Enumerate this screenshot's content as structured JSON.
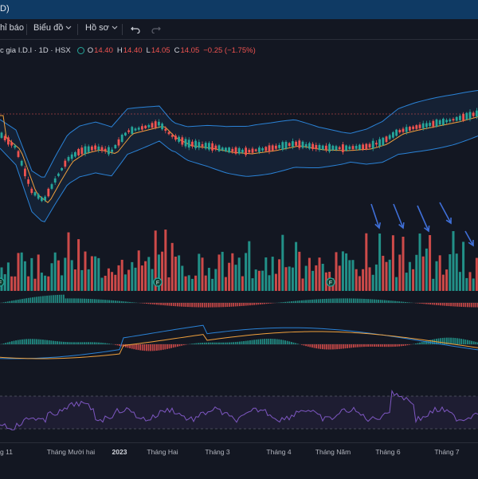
{
  "window": {
    "title_fragment": "D)"
  },
  "toolbar": {
    "indicators_label": "hỉ báo",
    "chart_label": "Biểu đồ",
    "profile_label": "Hồ sơ"
  },
  "legend": {
    "symbol": "c gia I.D.I · 1D · HSX",
    "open_key": "O",
    "open": "14.40",
    "high_key": "H",
    "high": "14.40",
    "low_key": "L",
    "low": "14.05",
    "close_key": "C",
    "close": "14.05",
    "change": "−0.25 (−1.75%)"
  },
  "colors": {
    "up": "#26a69a",
    "down": "#ef5350",
    "band": "#2a82d6",
    "ma_orange": "#f0a03c",
    "rsi": "#7e57c2",
    "arrow": "#3f6fd8",
    "topbar": "#0f3a64"
  },
  "event_markers": [
    "F",
    "F",
    "F"
  ],
  "time_axis": {
    "ticks": [
      {
        "label": "g 11",
        "bold": false
      },
      {
        "label": "Tháng Mười hai",
        "bold": false
      },
      {
        "label": "2023",
        "bold": true
      },
      {
        "label": "Tháng Hai",
        "bold": false
      },
      {
        "label": "Tháng 3",
        "bold": false
      },
      {
        "label": "Tháng 4",
        "bold": false
      },
      {
        "label": "Tháng Năm",
        "bold": false
      },
      {
        "label": "Tháng 6",
        "bold": false
      },
      {
        "label": "Tháng 7",
        "bold": false
      }
    ]
  },
  "annotations": {
    "arrow_count": 5
  }
}
